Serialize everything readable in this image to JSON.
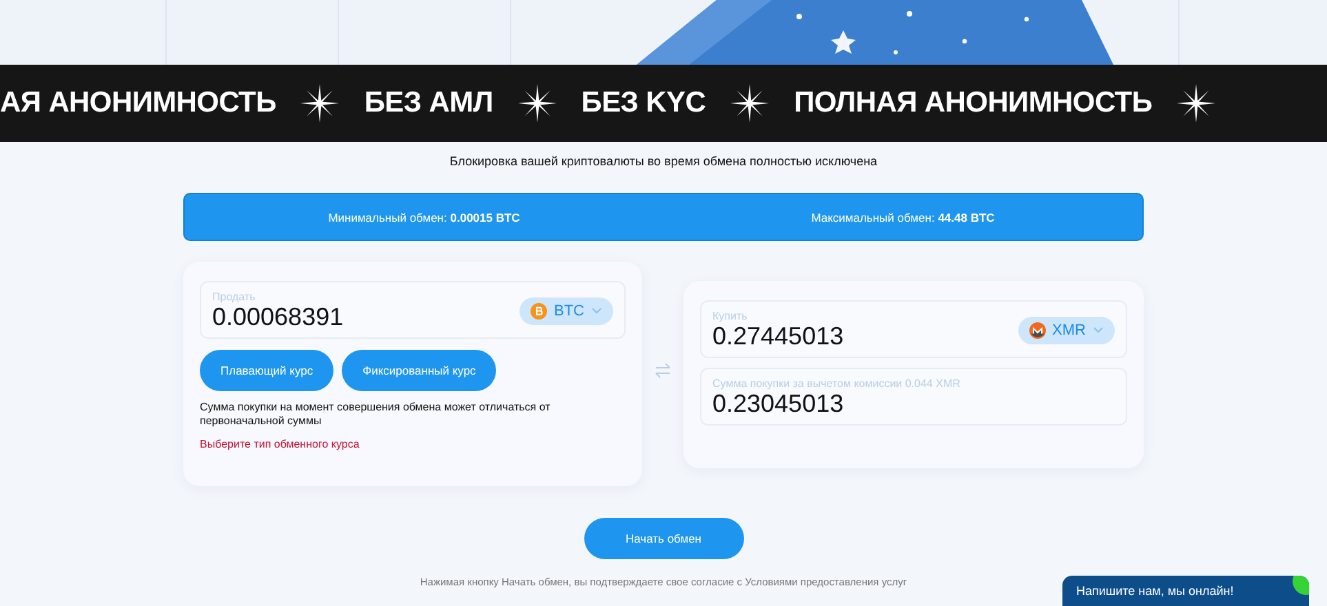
{
  "ticker": [
    "АЯ АНОНИМНОСТЬ",
    "БЕЗ АМЛ",
    "БЕЗ KYC",
    "ПОЛНАЯ АНОНИМНОСТЬ"
  ],
  "notice": "Блокировка вашей криптовалюты во время обмена полностью исключена",
  "limits": [
    {
      "label": "Минимальный обмен:",
      "value": "0.00015 BTC"
    },
    {
      "label": "Максимальный обмен:",
      "value": "44.48 BTC"
    }
  ],
  "sell": {
    "label": "Продать",
    "value": "0.00068391",
    "currency": "BTC",
    "kind": "btc"
  },
  "rate_buttons": [
    "Плавающий курс",
    "Фиксированный курс"
  ],
  "rate_note": "Сумма покупки на момент совершения обмена может отличаться от первоначальной суммы",
  "rate_error": "Выберите тип обменного курса",
  "buy": {
    "label": "Купить",
    "value": "0.27445013",
    "currency": "XMR",
    "kind": "xmr"
  },
  "net": {
    "label": "Сумма покупки за вычетом комиссии 0.044 XMR",
    "value": "0.23045013"
  },
  "start_button": "Начать обмен",
  "terms": "Нажимая кнопку Начать обмен, вы подтверждаете свое согласие с Условиями предоставления услуг",
  "chat": "Напишите нам, мы онлайн!"
}
